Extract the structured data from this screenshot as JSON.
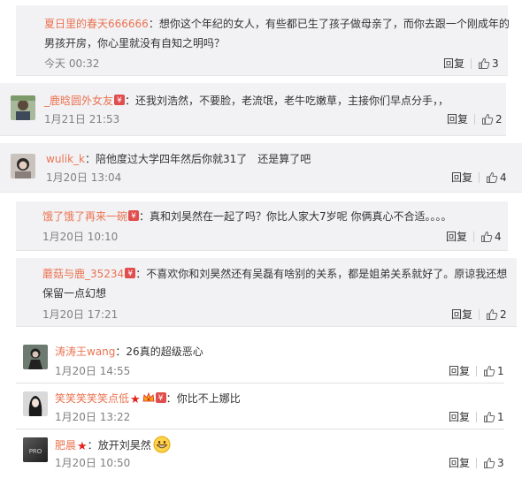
{
  "comments": [
    {
      "user": "夏日里的春天666666",
      "text": "想你这个年纪的女人，有些都已生了孩子做母亲了，而你去跟一个刚成年的",
      "text2": "男孩开房，你心里就没有自知之明吗？",
      "time": "今天 00:32",
      "reply": "回复",
      "likes": "3"
    },
    {
      "user": "_鹿晗圆外女友",
      "text": "还我刘浩然，不要脸，老流氓，老牛吃嫩草，主接你们早点分手，，",
      "time": "1月21日 21:53",
      "reply": "回复",
      "likes": "2"
    },
    {
      "user": "wulik_k",
      "text": "陪他度过大学四年然后你就31了　还是算了吧",
      "time": "1月20日 13:04",
      "reply": "回复",
      "likes": "4"
    },
    {
      "user": "饿了饿了再来一碗",
      "text": "真和刘昊然在一起了吗？你比人家大7岁呢 你俩真心不合适。。。。",
      "time": "1月20日 10:10",
      "reply": "回复",
      "likes": "4"
    },
    {
      "user": "蘑菇与鹿_35234",
      "text": "不喜欢你和刘昊然还有吴磊有啥别的关系，都是姐弟关系就好了。原谅我还想",
      "text2": "保留一点幻想",
      "time": "1月20日 17:21",
      "reply": "回复",
      "likes": "2"
    },
    {
      "user": "涛涛王wang",
      "text": "26真的超级恶心",
      "time": "1月20日 14:55",
      "reply": "回复",
      "likes": "1"
    },
    {
      "user": "笑笑笑笑笑点低",
      "text": "你比不上娜比",
      "time": "1月20日 13:22",
      "reply": "回复",
      "likes": "1"
    },
    {
      "user": "肥晨",
      "text": "放开刘昊然",
      "time": "1月20日 10:50",
      "reply": "回复",
      "likes": "3"
    }
  ],
  "colon": "：",
  "avatar_text": "PRO",
  "colors": {
    "username": "#eb7350",
    "card_bg": "#f2f2f5",
    "badge": "#e14d4d"
  },
  "icons": {
    "like": "thumbs-up-icon",
    "badge": "red-envelope-badge-icon",
    "star": "red-star-icon",
    "crown": "vip-crown-icon",
    "emoji": "grin-emoji-icon"
  }
}
